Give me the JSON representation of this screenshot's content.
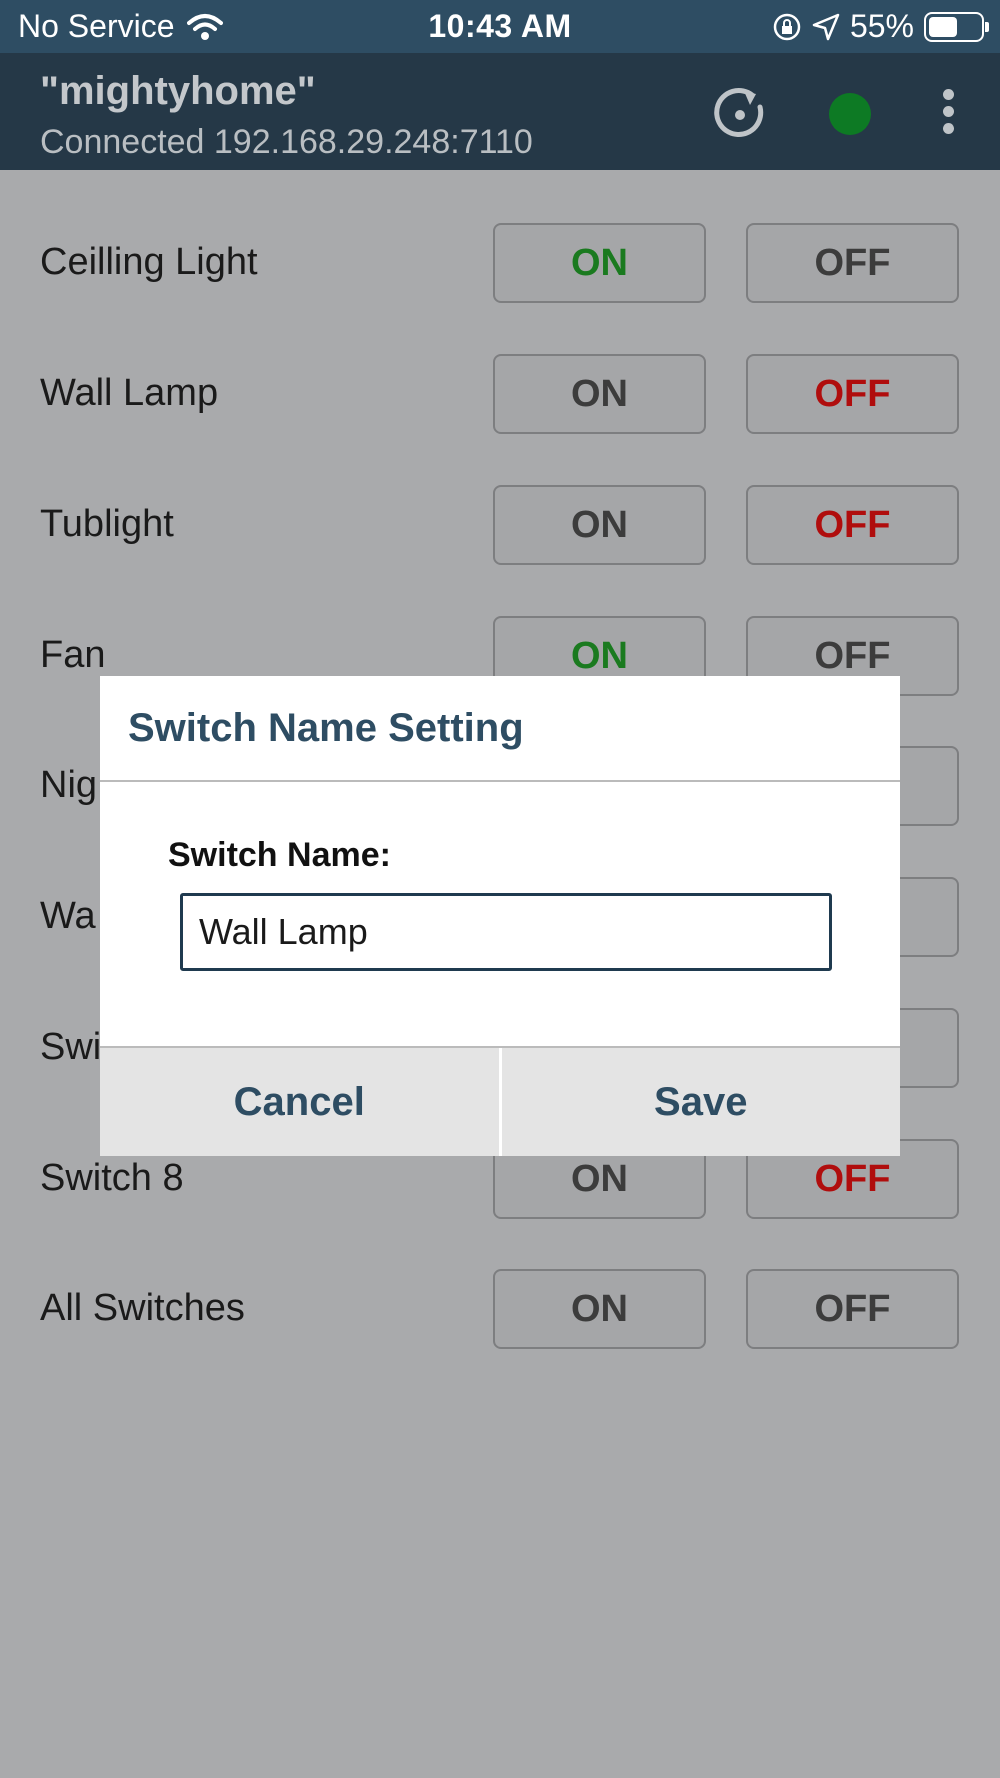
{
  "status_bar": {
    "carrier": "No Service",
    "time": "10:43 AM",
    "battery_percent": "55%",
    "battery_level": 0.55,
    "icons": [
      "wifi-icon",
      "orientation-lock-icon",
      "location-arrow-icon",
      "battery-icon"
    ]
  },
  "app_bar": {
    "title": "\"mightyhome\"",
    "subtitle": "Connected 192.168.29.248:7110",
    "connection_color": "#0d7a24",
    "icons": [
      "refresh-icon",
      "connection-status-icon",
      "more-vert-icon"
    ]
  },
  "switches": [
    {
      "name": "Ceilling Light",
      "on_label": "ON",
      "off_label": "OFF",
      "state": "on"
    },
    {
      "name": "Wall Lamp",
      "on_label": "ON",
      "off_label": "OFF",
      "state": "off"
    },
    {
      "name": "Tublight",
      "on_label": "ON",
      "off_label": "OFF",
      "state": "off"
    },
    {
      "name": "Fan",
      "on_label": "ON",
      "off_label": "OFF",
      "state": "on"
    },
    {
      "name": "Nig",
      "on_label": "",
      "off_label": "",
      "state": "hidden"
    },
    {
      "name": "Wa",
      "on_label": "",
      "off_label": "",
      "state": "hidden"
    },
    {
      "name": "Swi",
      "on_label": "",
      "off_label": "",
      "state": "hidden"
    },
    {
      "name": "Switch 8",
      "on_label": "ON",
      "off_label": "OFF",
      "state": "off"
    },
    {
      "name": "All Switches",
      "on_label": "ON",
      "off_label": "OFF",
      "state": "none"
    }
  ],
  "colors": {
    "on_active": "#1a7a1f",
    "off_active": "#b00d0d",
    "accent": "#2e4d63"
  },
  "dialog": {
    "title": "Switch Name Setting",
    "field_label": "Switch Name:",
    "field_value": "Wall Lamp",
    "cancel_label": "Cancel",
    "save_label": "Save"
  }
}
